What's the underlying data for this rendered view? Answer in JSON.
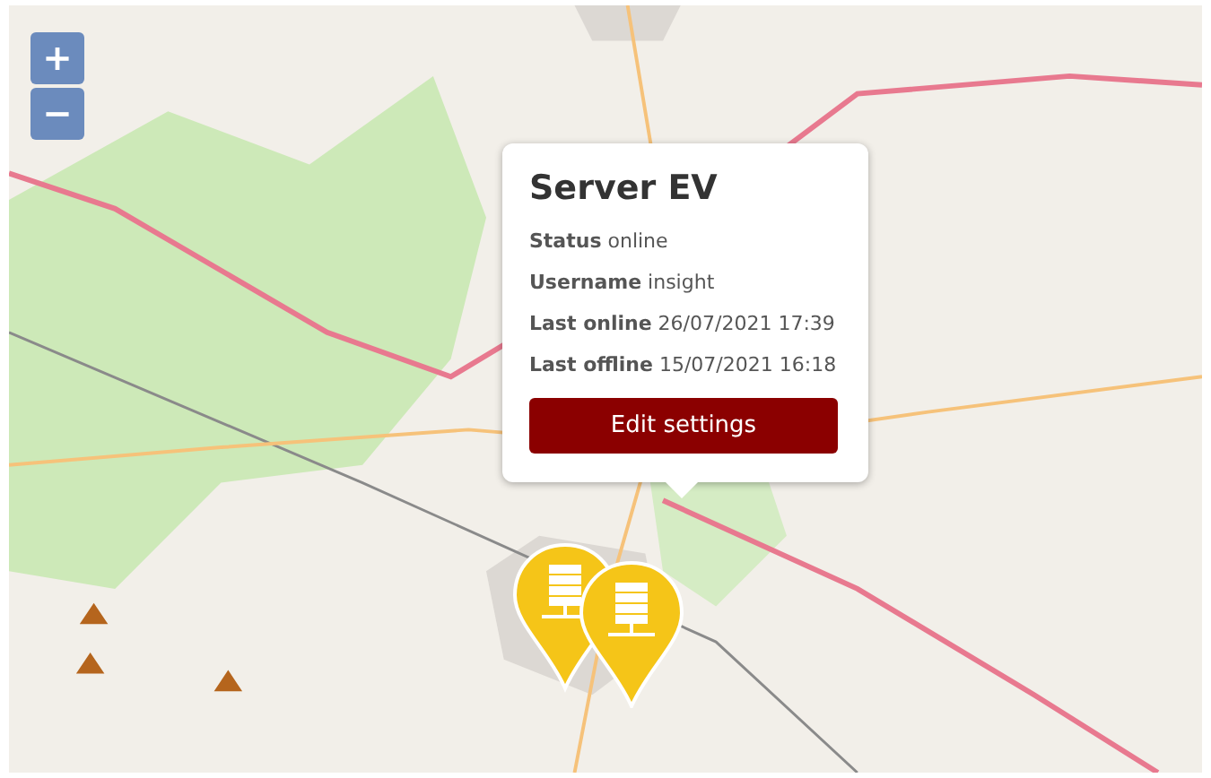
{
  "zoom_controls": [
    {
      "label": "+"
    },
    {
      "label": "−"
    }
  ],
  "popup": {
    "title": "Server EV",
    "fields": [
      "**Status** online",
      "**Username** insight",
      "**Last online** 26/07/2021 17:39",
      "**Last offline** 15/07/2021 16:18"
    ],
    "button": "Edit settings"
  }
}
